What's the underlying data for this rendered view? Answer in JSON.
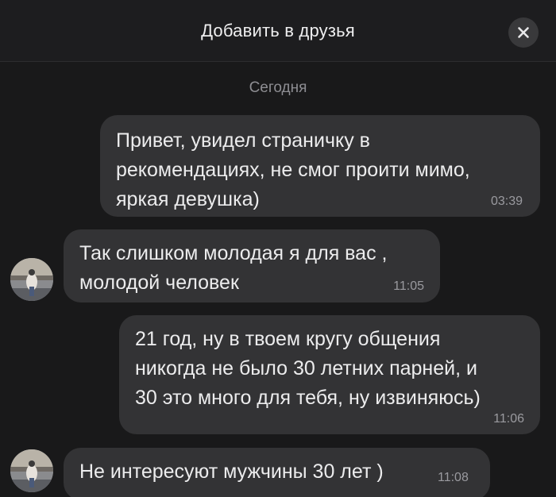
{
  "header": {
    "title": "Добавить в друзья"
  },
  "chat": {
    "date_separator": "Сегодня",
    "messages": [
      {
        "text": "Привет, увидел страничку в\nрекомендациях, не смог проити мимо,\nяркая девушка)",
        "time": "03:39",
        "direction": "outgoing"
      },
      {
        "text": "Так слишком молодая я для вас ,\nмолодой человек",
        "time": "11:05",
        "direction": "incoming"
      },
      {
        "text": "21 год, ну в твоем кругу общения\nникогда не было 30 летних парней, и\n30 это много для тебя, ну извиняюсь)",
        "time": "11:06",
        "direction": "outgoing"
      },
      {
        "text": "Не интересуют мужчины 30 лет )",
        "time": "11:08",
        "direction": "incoming"
      }
    ]
  },
  "colors": {
    "background": "#19191a",
    "bubble": "#333335",
    "header": "#1d1d1f"
  }
}
